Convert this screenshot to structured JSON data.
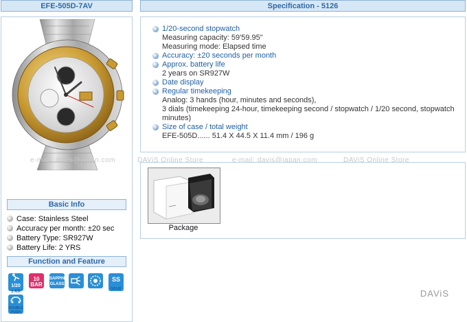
{
  "left_header": {
    "title": "EFE-505D-7AV"
  },
  "right_header": {
    "title": "Specification - 5126"
  },
  "basic_info": {
    "title": "Basic Info",
    "items": [
      "Case: Stainless Steel",
      "Accuracy per month: ±20 sec",
      "Battery Type: SR927W",
      "Battery Life: 2 YRS"
    ]
  },
  "function_feature": {
    "title": "Function and Feature",
    "icons": [
      {
        "name": "stopwatch-1-20-icon",
        "label": "1/20",
        "sub": "1 KR"
      },
      {
        "name": "water-resist-10bar-icon",
        "label": "10 BAR"
      },
      {
        "name": "sapphire-glass-icon",
        "label": "SAPPHIRE GLASS"
      },
      {
        "name": "light-icon",
        "label": ""
      },
      {
        "name": "screw-back-icon",
        "label": ""
      },
      {
        "name": "solid-stainless-icon",
        "label": "SS",
        "sub": "SOLID"
      },
      {
        "name": "double-push-icon",
        "label": "DOUBLE PUSH"
      }
    ],
    "colors": {
      "blue": "#2a8fd6",
      "pink": "#e0306a"
    }
  },
  "specs": [
    {
      "title": "1/20-second stopwatch",
      "details": [
        "Measuring capacity: 59'59.95\"",
        "Measuring mode: Elapsed time"
      ]
    },
    {
      "title": "Accuracy: ±20 seconds per month",
      "details": []
    },
    {
      "title": "Approx. battery life",
      "details": [
        "2 years on SR927W"
      ]
    },
    {
      "title": "Date display",
      "details": []
    },
    {
      "title": "Regular timekeeping",
      "details": [
        "Analog: 3 hands (hour, minutes and seconds),",
        "3 dials (timekeeping 24-hour, timekeeping second / stopwatch / 1/20 second, stopwatch minutes)"
      ]
    },
    {
      "title": "Size of case / total weight",
      "details": [
        "EFE-505D...... 51.4 X 44.5 X 11.4 mm / 196 g"
      ]
    }
  ],
  "watermark": {
    "text1": "e-mail: davis@japan.com",
    "text2": "DAViS Online Store"
  },
  "package": {
    "label": "Package"
  },
  "brand": {
    "text": "DAViS"
  }
}
